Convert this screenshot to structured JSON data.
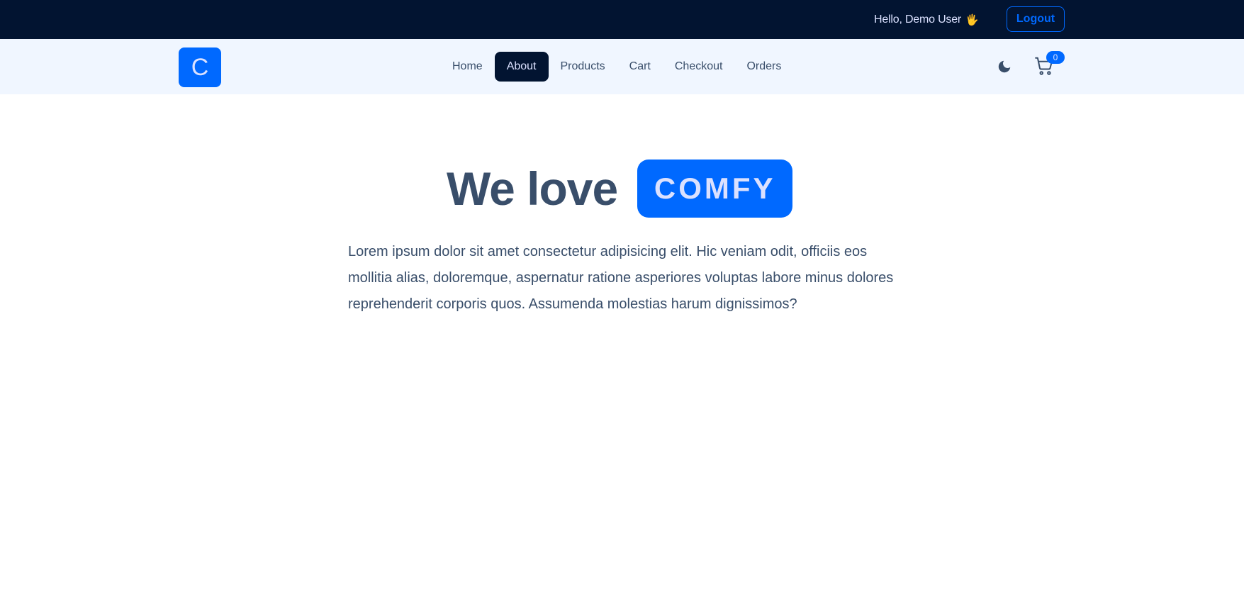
{
  "topbar": {
    "greeting": "Hello, Demo User",
    "wave_emoji": "🖐",
    "logout_label": "Logout"
  },
  "navbar": {
    "logo_letter": "C",
    "links": [
      {
        "label": "Home",
        "active": false
      },
      {
        "label": "About",
        "active": true
      },
      {
        "label": "Products",
        "active": false
      },
      {
        "label": "Cart",
        "active": false
      },
      {
        "label": "Checkout",
        "active": false
      },
      {
        "label": "Orders",
        "active": false
      }
    ],
    "theme_icon": "moon-icon",
    "cart_icon": "cart-icon",
    "cart_count": "0"
  },
  "hero": {
    "headline": "We love",
    "brand": "COMFY",
    "paragraph": "Lorem ipsum dolor sit amet consectetur adipisicing elit. Hic veniam odit, officiis eos mollitia alias, doloremque, aspernatur ratione asperiores voluptas labore minus dolores reprehenderit corporis quos. Assumenda molestias harum dignissimos?"
  },
  "colors": {
    "topbar_bg": "#021431",
    "nav_bg": "#f0f6ff",
    "primary": "#0069ff",
    "text": "#394e6a"
  }
}
